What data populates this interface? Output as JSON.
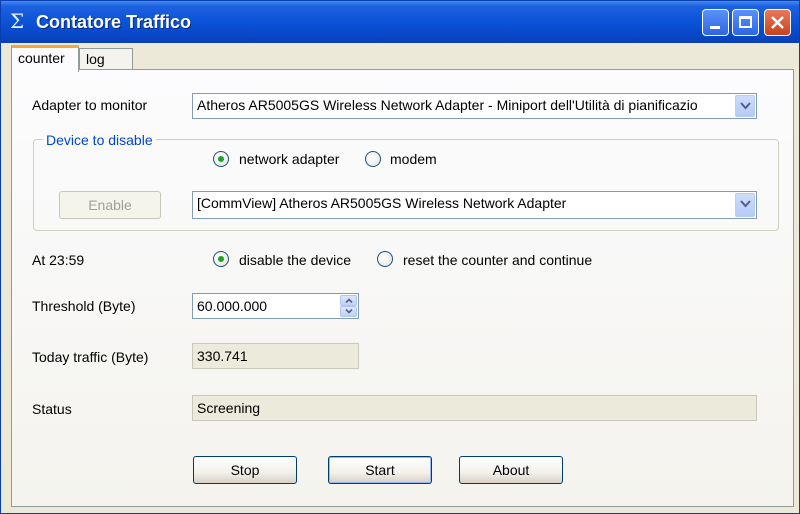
{
  "window": {
    "title": "Contatore Traffico",
    "icon": "sigma-icon"
  },
  "tabs": [
    {
      "label": "counter",
      "active": true
    },
    {
      "label": "log",
      "active": false
    }
  ],
  "adapter": {
    "label": "Adapter to monitor",
    "selected": "Atheros AR5005GS Wireless Network Adapter - Miniport dell'Utilità di pianificazio"
  },
  "device_group": {
    "legend": "Device to disable",
    "options": [
      {
        "label": "network adapter",
        "checked": true
      },
      {
        "label": "modem",
        "checked": false
      }
    ],
    "enable_button": "Enable",
    "enable_disabled": true,
    "device_selected": "[CommView] Atheros AR5005GS Wireless Network Adapter"
  },
  "schedule": {
    "label": "At 23:59",
    "options": [
      {
        "label": "disable the device",
        "checked": true
      },
      {
        "label": "reset the counter and continue",
        "checked": false
      }
    ]
  },
  "threshold": {
    "label": "Threshold (Byte)",
    "value": "60.000.000"
  },
  "today": {
    "label": "Today traffic (Byte)",
    "value": "330.741"
  },
  "status": {
    "label": "Status",
    "value": "Screening"
  },
  "buttons": {
    "stop": "Stop",
    "start": "Start",
    "about": "About"
  },
  "colors": {
    "title_bar": "#0a52d8",
    "group_legend": "#0046d5",
    "radio_dot": "#21a121",
    "active_tab_accent": "#f2a93b"
  }
}
